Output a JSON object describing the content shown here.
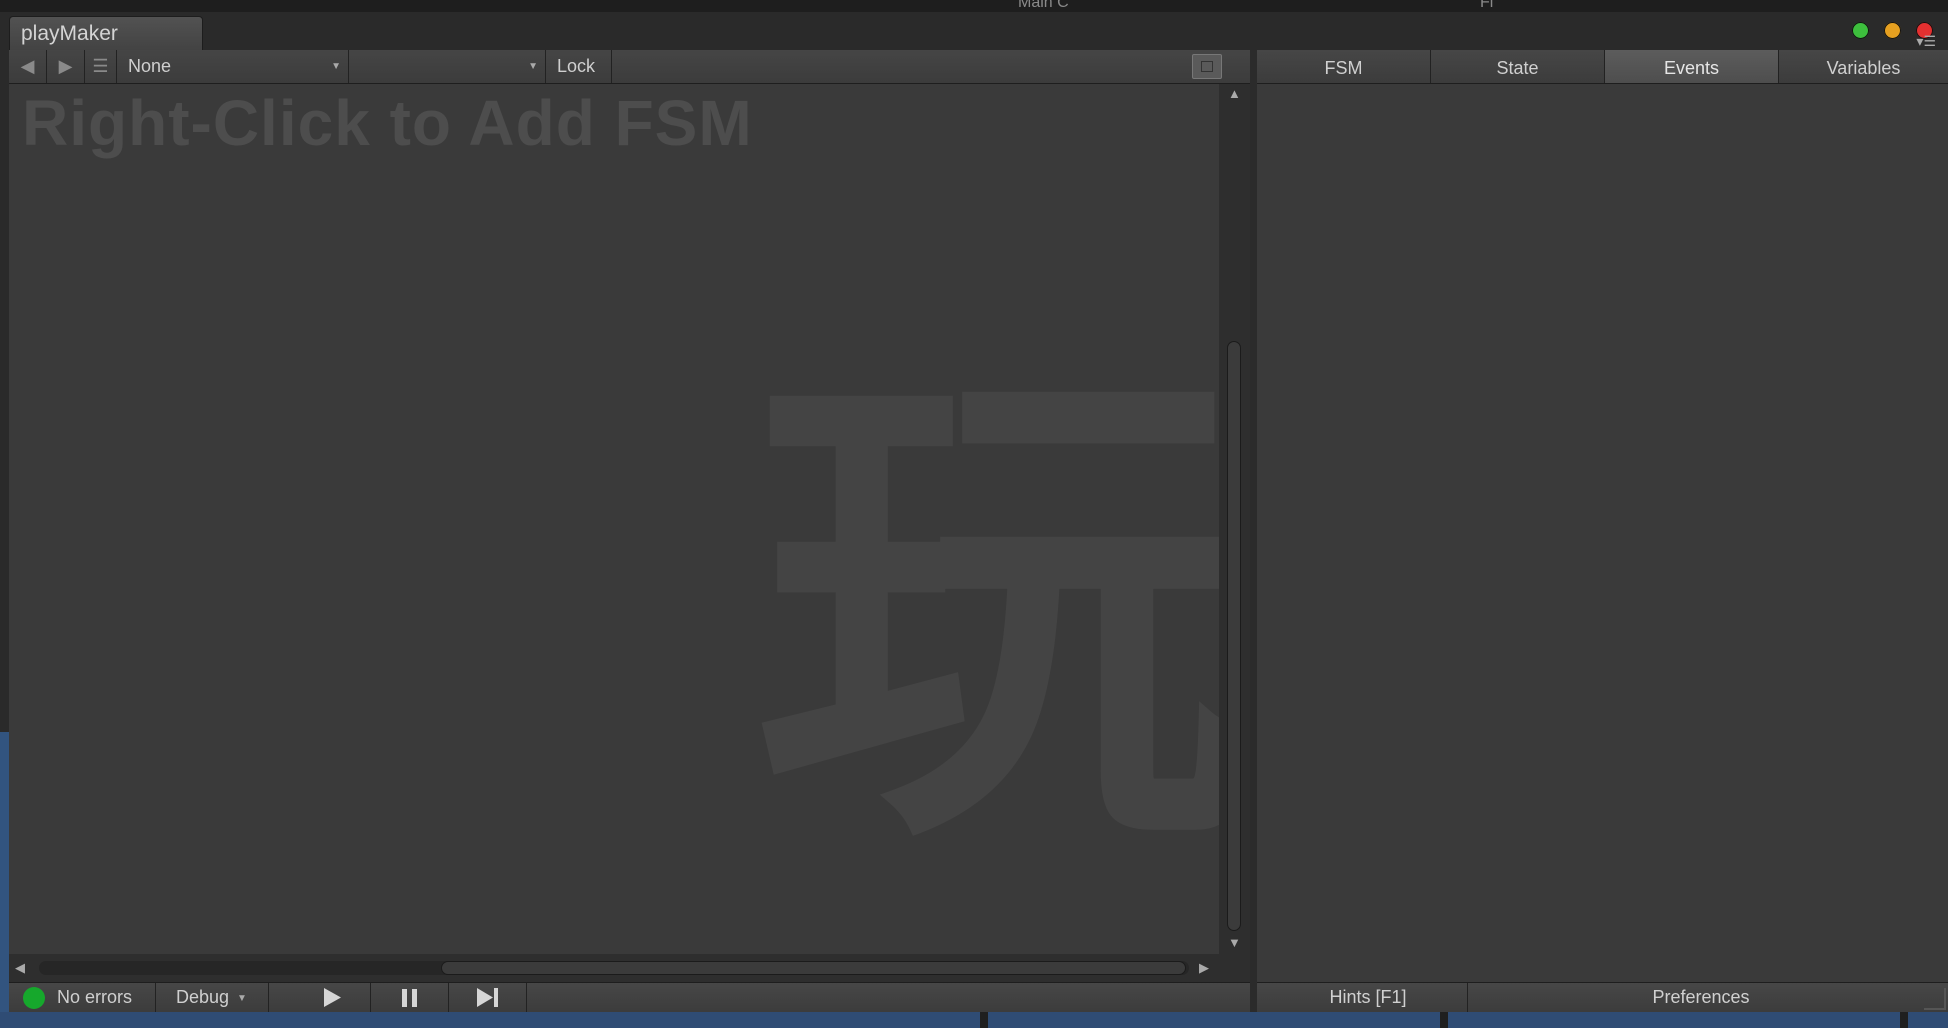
{
  "window": {
    "title": "playMaker",
    "traffic_lights": [
      "#3dbf3d",
      "#e6a020",
      "#e43030"
    ]
  },
  "background_ghost": {
    "left_text": "Main C",
    "right_text": "Fi"
  },
  "toolbar": {
    "back_icon": "arrow-left-icon",
    "forward_icon": "arrow-right-icon",
    "list_icon": "list-icon",
    "fsm_select": "None",
    "state_select": "",
    "lock_label": "Lock",
    "graph_view_icon": "graph-view-icon"
  },
  "canvas": {
    "hint": "Right-Click to Add FSM",
    "watermark": "玩"
  },
  "status_bar": {
    "status_text": "No errors",
    "status_color": "#16a82c",
    "debug_label": "Debug",
    "play_icon": "▶",
    "pause_icon": "❚❚",
    "step_icon": "▶|"
  },
  "inspector": {
    "tabs": [
      {
        "label": "FSM",
        "active": false
      },
      {
        "label": "State",
        "active": false
      },
      {
        "label": "Events",
        "active": true
      },
      {
        "label": "Variables",
        "active": false
      }
    ],
    "hints_label": "Hints [F1]",
    "preferences_label": "Preferences"
  }
}
